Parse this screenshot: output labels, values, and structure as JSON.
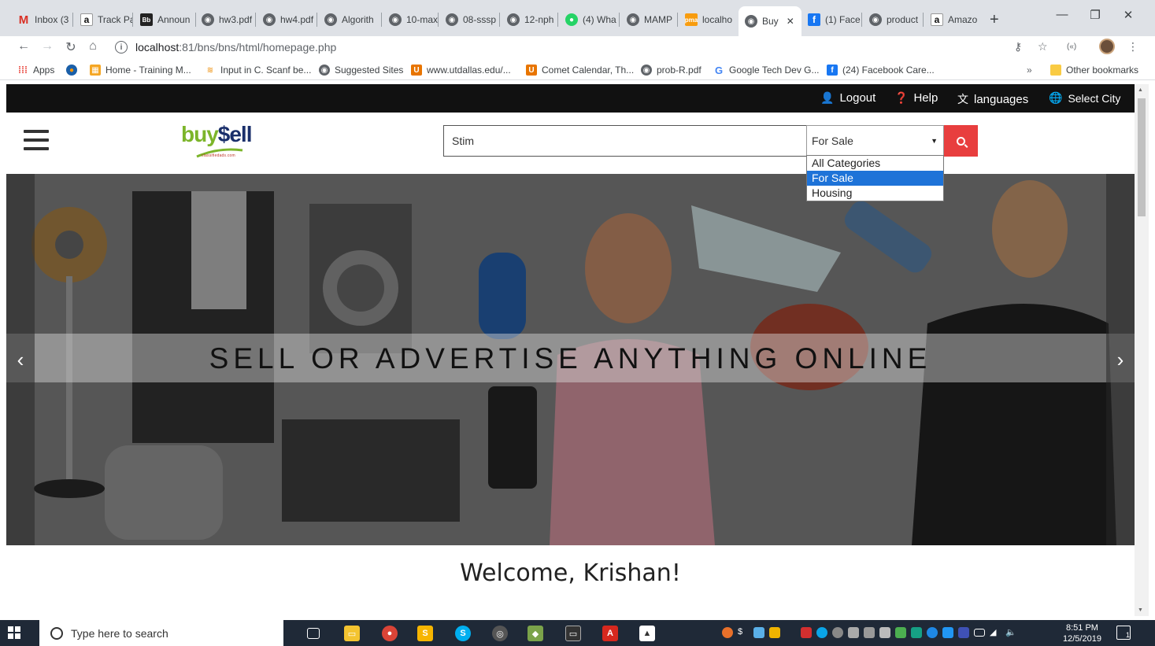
{
  "browser": {
    "tabs": [
      {
        "title": "Inbox (3",
        "favicon": "gmail-icon"
      },
      {
        "title": "Track Pa",
        "favicon": "amazon-icon"
      },
      {
        "title": "Announ",
        "favicon": "blackboard-icon"
      },
      {
        "title": "hw3.pdf",
        "favicon": "globe-icon"
      },
      {
        "title": "hw4.pdf",
        "favicon": "globe-icon"
      },
      {
        "title": "Algorith",
        "favicon": "globe-icon"
      },
      {
        "title": "10-max",
        "favicon": "globe-icon"
      },
      {
        "title": "08-sssp",
        "favicon": "globe-icon"
      },
      {
        "title": "12-nph",
        "favicon": "globe-icon"
      },
      {
        "title": "(4) Wha",
        "favicon": "whatsapp-icon"
      },
      {
        "title": "MAMP",
        "favicon": "globe-icon"
      },
      {
        "title": "localho",
        "favicon": "phpmyadmin-icon"
      },
      {
        "title": "Buy",
        "favicon": "globe-icon",
        "active": true
      },
      {
        "title": "(1) Face",
        "favicon": "facebook-icon"
      },
      {
        "title": "product",
        "favicon": "globe-icon"
      },
      {
        "title": "Amazo",
        "favicon": "amazon-icon"
      }
    ],
    "url_host": "localhost",
    "url_path": ":81/bns/bns/html/homepage.php",
    "bookmarks": [
      "Apps",
      "",
      "Home - Training M...",
      "Input in C. Scanf be...",
      "Suggested Sites",
      "www.utdallas.edu/...",
      "Comet Calendar, Th...",
      "prob-R.pdf",
      "Google Tech Dev G...",
      "(24) Facebook Care...",
      "Other bookmarks"
    ],
    "bookmarks_overflow": "»"
  },
  "topbar": {
    "logout": "Logout",
    "help": "Help",
    "languages": "languages",
    "select_city": "Select City"
  },
  "header": {
    "logo_buy": "buy",
    "logo_sell": "$ell",
    "logo_tagline": "classifiedads.com",
    "search_value": "Stim",
    "category_selected": "For Sale",
    "category_options": [
      "All Categories",
      "For Sale",
      "Housing"
    ]
  },
  "hero": {
    "title": "SELL OR ADVERTISE ANYTHING ONLINE",
    "prev": "‹",
    "next": "›"
  },
  "welcome": "Welcome, Krishan!",
  "taskbar": {
    "search_placeholder": "Type here to search",
    "time": "8:51 PM",
    "date": "12/5/2019",
    "notification_count": "1"
  },
  "colors": {
    "accent_red": "#e83e3e",
    "topbar_bg": "#111111",
    "selected_option": "#1e73d8",
    "logo_green": "#7cb52a",
    "logo_navy": "#1a2f6b"
  }
}
